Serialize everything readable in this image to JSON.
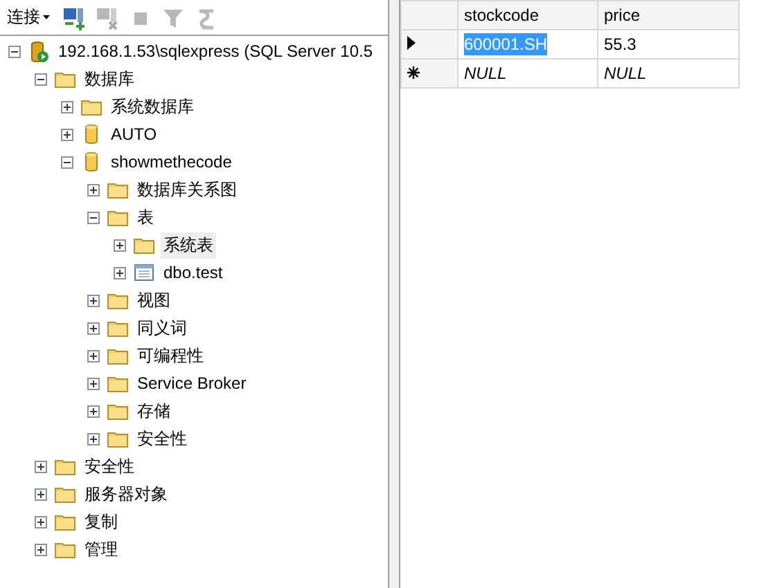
{
  "toolbar": {
    "connect_label": "连接",
    "tools": [
      {
        "disabled": false
      },
      {
        "disabled": true
      },
      {
        "disabled": true
      },
      {
        "disabled": true
      },
      {
        "disabled": true
      }
    ]
  },
  "tree": [
    {
      "label": "192.168.1.53\\sqlexpress (SQL Server 10.5",
      "kind": "server",
      "expanded": true,
      "selected": false,
      "children": [
        {
          "label": "数据库",
          "kind": "folder",
          "expanded": true,
          "selected": false,
          "children": [
            {
              "label": "系统数据库",
              "kind": "folder",
              "expanded": false,
              "selected": false
            },
            {
              "label": "AUTO",
              "kind": "database",
              "expanded": false,
              "selected": false
            },
            {
              "label": "showmethecode",
              "kind": "database",
              "expanded": true,
              "selected": false,
              "children": [
                {
                  "label": "数据库关系图",
                  "kind": "folder",
                  "expanded": false,
                  "selected": false
                },
                {
                  "label": "表",
                  "kind": "folder",
                  "expanded": true,
                  "selected": false,
                  "children": [
                    {
                      "label": "系统表",
                      "kind": "folder",
                      "expanded": false,
                      "selected": true
                    },
                    {
                      "label": "dbo.test",
                      "kind": "table",
                      "expanded": false,
                      "selected": false
                    }
                  ]
                },
                {
                  "label": "视图",
                  "kind": "folder",
                  "expanded": false,
                  "selected": false
                },
                {
                  "label": "同义词",
                  "kind": "folder",
                  "expanded": false,
                  "selected": false
                },
                {
                  "label": "可编程性",
                  "kind": "folder",
                  "expanded": false,
                  "selected": false
                },
                {
                  "label": "Service Broker",
                  "kind": "folder",
                  "expanded": false,
                  "selected": false
                },
                {
                  "label": "存储",
                  "kind": "folder",
                  "expanded": false,
                  "selected": false
                },
                {
                  "label": "安全性",
                  "kind": "folder",
                  "expanded": false,
                  "selected": false
                }
              ]
            }
          ]
        },
        {
          "label": "安全性",
          "kind": "folder",
          "expanded": false,
          "selected": false
        },
        {
          "label": "服务器对象",
          "kind": "folder",
          "expanded": false,
          "selected": false
        },
        {
          "label": "复制",
          "kind": "folder",
          "expanded": false,
          "selected": false
        },
        {
          "label": "管理",
          "kind": "folder",
          "expanded": false,
          "selected": false
        }
      ]
    }
  ],
  "grid": {
    "columns": [
      "stockcode",
      "price"
    ],
    "rows": [
      {
        "kind": "current",
        "cells": [
          {
            "text": "600001.SH",
            "selected": true,
            "null": false
          },
          {
            "text": "55.3",
            "selected": false,
            "null": false
          }
        ]
      },
      {
        "kind": "new",
        "cells": [
          {
            "text": "NULL",
            "selected": false,
            "null": true
          },
          {
            "text": "NULL",
            "selected": false,
            "null": true
          }
        ]
      }
    ]
  }
}
